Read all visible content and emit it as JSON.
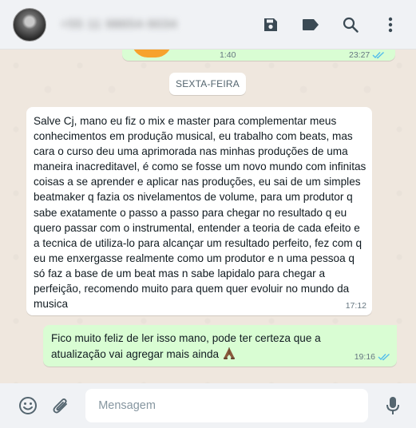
{
  "header": {
    "contact_name": "+55 11 98654-9034",
    "icons": [
      "save-icon",
      "label-tag-icon",
      "search-icon",
      "menu-dots-icon"
    ]
  },
  "previous_message": {
    "duration": "1:40",
    "time": "23:27",
    "status": "read"
  },
  "date_chip": "SEXTA-FEIRA",
  "messages": [
    {
      "direction": "incoming",
      "text": "Salve Cj, mano eu fiz o mix e master para complementar meus conhecimentos em produção musical, eu trabalho com beats, mas cara o curso deu uma aprimorada nas minhas produções de uma maneira inacreditavel, é como se fosse um novo mundo com infinitas coisas a se aprender e aplicar nas produções, eu sai de um simples beatmaker q fazia os nivelamentos de volume, para um produtor q sabe exatamente o passo a passo para chegar no resultado q eu quero passar com o instrumental, entender a teoria de cada efeito e a tecnica de utiliza-lo para alcançar um resultado perfeito, fez com q eu me enxergasse realmente como um produtor e n uma pessoa q só faz a base de um beat mas n sabe lapidalo para chegar a perfeição, recomendo muito para quem quer evoluir no mundo da musica",
      "time": "17:12"
    },
    {
      "direction": "outgoing",
      "text": "Fico muito feliz de ler isso mano, pode ter certeza que a atualização vai agregar mais ainda ",
      "emoji": "folded-hands-emoji",
      "time": "19:16",
      "status": "read"
    }
  ],
  "composer": {
    "placeholder": "Mensagem",
    "icons": [
      "emoji-icon",
      "attach-icon",
      "microphone-icon"
    ]
  },
  "colors": {
    "outgoing_bubble": "#d9fdd3",
    "incoming_bubble": "#ffffff",
    "chat_background": "#efe7de",
    "read_ticks": "#53bdeb",
    "header_bg": "#f0f2f5"
  }
}
